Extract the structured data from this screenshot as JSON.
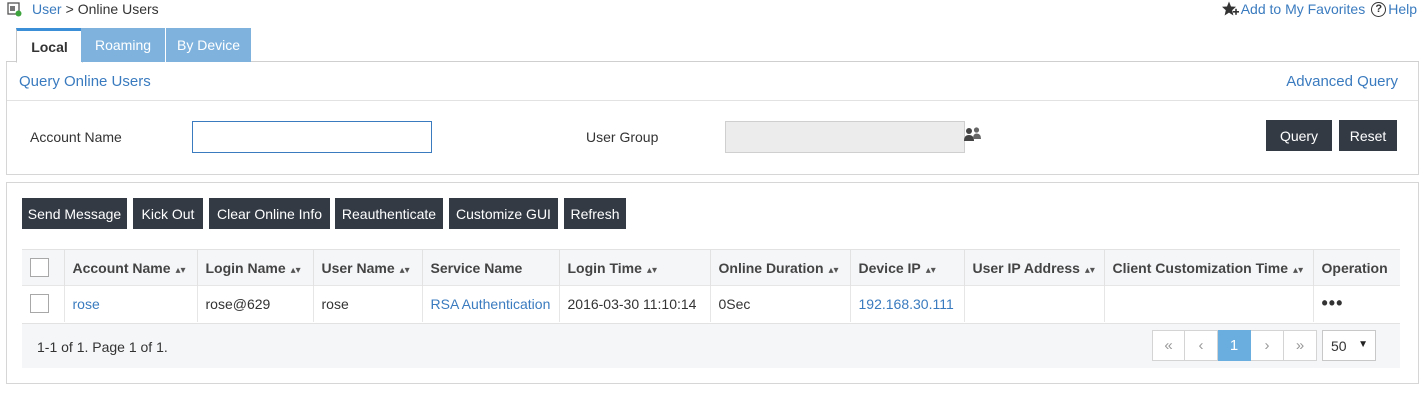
{
  "breadcrumb": {
    "root": "User",
    "separator": ">",
    "current": "Online Users"
  },
  "top_actions": {
    "favorites": "Add to My Favorites",
    "help": "Help"
  },
  "tabs": [
    {
      "label": "Local",
      "active": true
    },
    {
      "label": "Roaming",
      "active": false
    },
    {
      "label": "By Device",
      "active": false
    }
  ],
  "query": {
    "title": "Query Online Users",
    "advanced": "Advanced Query",
    "account_label": "Account Name",
    "account_value": "",
    "group_label": "User Group",
    "group_value": "",
    "query_button": "Query",
    "reset_button": "Reset"
  },
  "toolbar": {
    "send_message": "Send Message",
    "kick_out": "Kick Out",
    "clear_info": "Clear Online Info",
    "reauthenticate": "Reauthenticate",
    "customize_gui": "Customize GUI",
    "refresh": "Refresh"
  },
  "table": {
    "headers": {
      "account_name": "Account Name",
      "login_name": "Login Name",
      "user_name": "User Name",
      "service_name": "Service Name",
      "login_time": "Login Time",
      "online_duration": "Online Duration",
      "device_ip": "Device IP",
      "user_ip": "User IP Address",
      "client_time": "Client Customization Time",
      "operation": "Operation"
    },
    "rows": [
      {
        "account_name": "rose",
        "login_name": "rose@629",
        "user_name": "rose",
        "service_name": "RSA Authentication",
        "login_time": "2016-03-30 11:10:14",
        "online_duration": "0Sec",
        "device_ip": "192.168.30.111",
        "user_ip": "",
        "client_time": "",
        "operation": "•••"
      }
    ]
  },
  "pagination": {
    "info": "1-1 of 1. Page 1 of 1.",
    "first": "«",
    "prev": "‹",
    "current": "1",
    "next": "›",
    "last": "»",
    "page_size": "50"
  },
  "colors": {
    "accent": "#3a7bbf",
    "button_dark": "#333a44",
    "tab_inactive": "#7fb3de",
    "page_active": "#6aaee0"
  }
}
